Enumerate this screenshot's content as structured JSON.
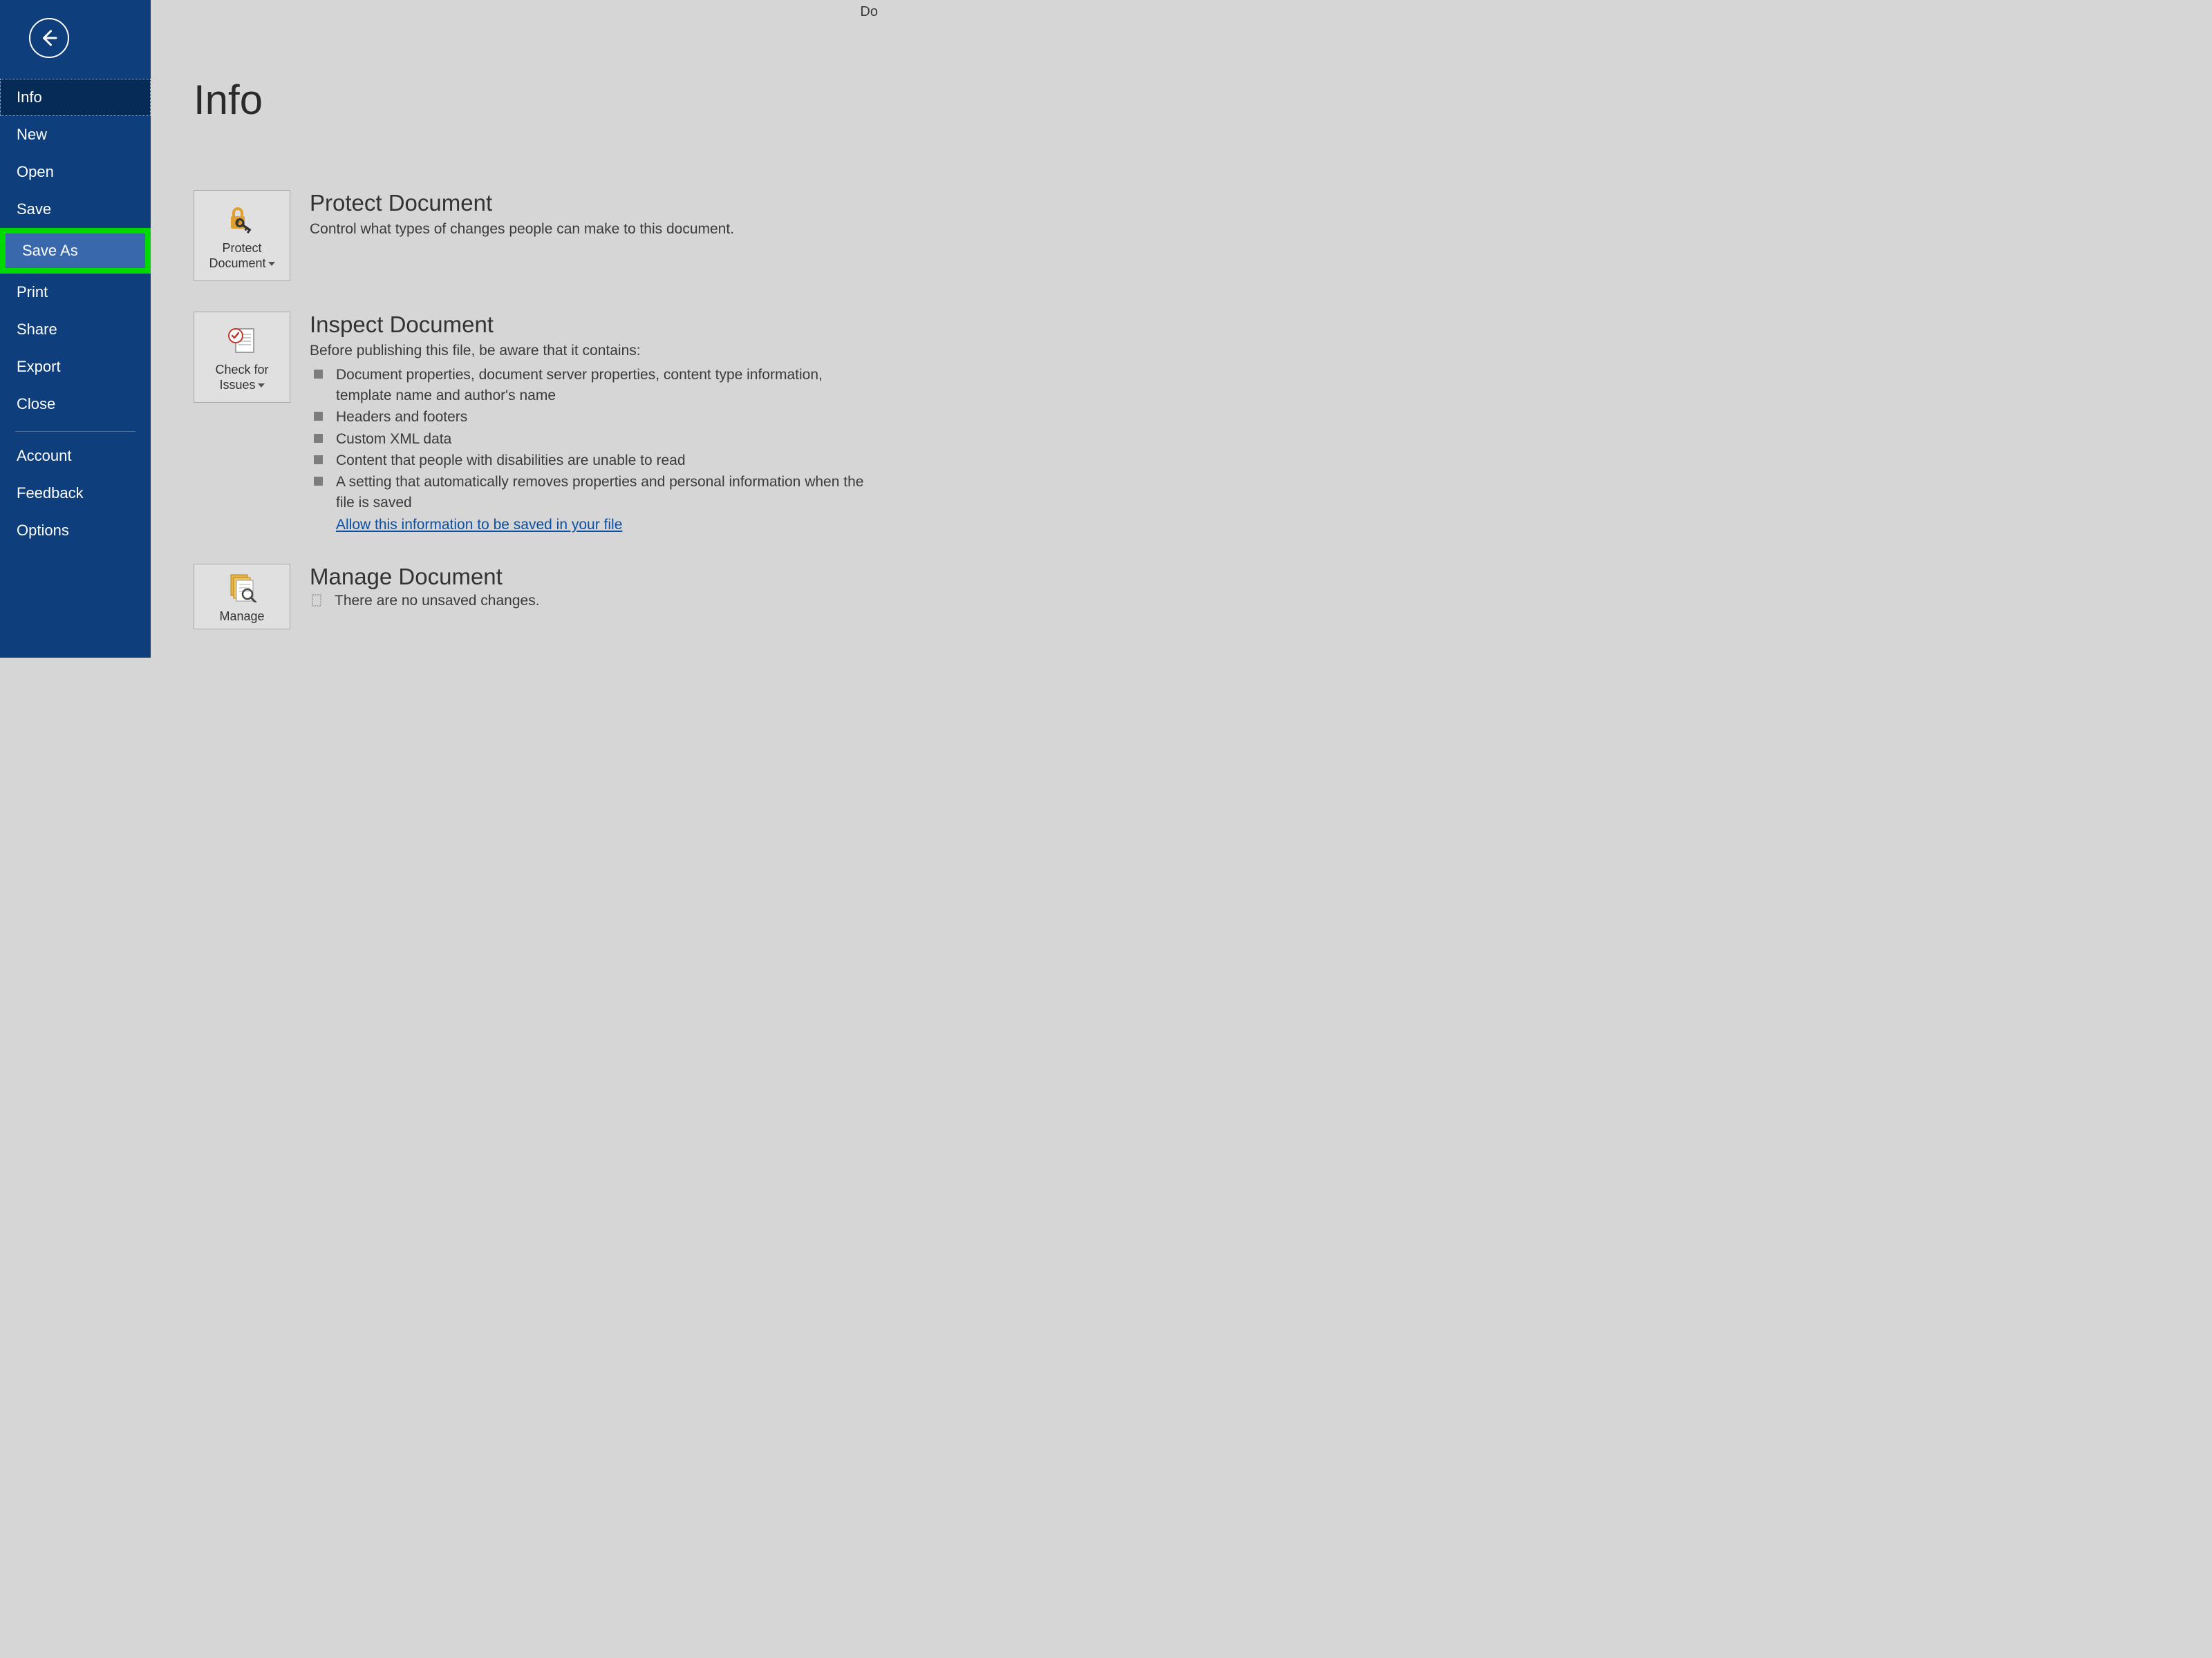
{
  "corner_text": "Do",
  "page_title": "Info",
  "sidebar": {
    "items": [
      {
        "label": "Info"
      },
      {
        "label": "New"
      },
      {
        "label": "Open"
      },
      {
        "label": "Save"
      },
      {
        "label": "Save As"
      },
      {
        "label": "Print"
      },
      {
        "label": "Share"
      },
      {
        "label": "Export"
      },
      {
        "label": "Close"
      }
    ],
    "footer": [
      {
        "label": "Account"
      },
      {
        "label": "Feedback"
      },
      {
        "label": "Options"
      }
    ]
  },
  "sections": {
    "protect": {
      "tile_line1": "Protect",
      "tile_line2": "Document",
      "heading": "Protect Document",
      "desc": "Control what types of changes people can make to this document."
    },
    "inspect": {
      "tile_line1": "Check for",
      "tile_line2": "Issues",
      "heading": "Inspect Document",
      "desc": "Before publishing this file, be aware that it contains:",
      "items": [
        "Document properties, document server properties, content type information, template name and author's name",
        "Headers and footers",
        "Custom XML data",
        "Content that people with disabilities are unable to read",
        "A setting that automatically removes properties and personal information when the file is saved"
      ],
      "link": "Allow this information to be saved in your file"
    },
    "manage": {
      "tile_line1": "Manage",
      "heading": "Manage Document",
      "desc": "There are no unsaved changes."
    }
  }
}
